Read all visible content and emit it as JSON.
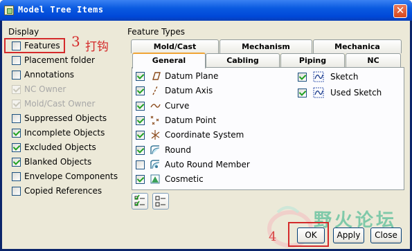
{
  "window": {
    "title": "Model Tree Items",
    "close_glyph": "✕"
  },
  "display": {
    "heading": "Display",
    "items": [
      {
        "label": "Features",
        "checked": false,
        "enabled": true
      },
      {
        "label": "Placement folder",
        "checked": false,
        "enabled": true
      },
      {
        "label": "Annotations",
        "checked": false,
        "enabled": true
      },
      {
        "label": "NC Owner",
        "checked": true,
        "enabled": false
      },
      {
        "label": "Mold/Cast Owner",
        "checked": true,
        "enabled": false
      },
      {
        "label": "Suppressed Objects",
        "checked": false,
        "enabled": true
      },
      {
        "label": "Incomplete Objects",
        "checked": true,
        "enabled": true
      },
      {
        "label": "Excluded Objects",
        "checked": true,
        "enabled": true
      },
      {
        "label": "Blanked Objects",
        "checked": true,
        "enabled": true
      },
      {
        "label": "Envelope Components",
        "checked": false,
        "enabled": true
      },
      {
        "label": "Copied References",
        "checked": false,
        "enabled": true
      }
    ]
  },
  "annotation_3": {
    "number": "3",
    "text": "打钩"
  },
  "annotation_4": {
    "number": "4"
  },
  "feature_types": {
    "heading": "Feature Types",
    "tabs_back": [
      "Mold/Cast",
      "Mechanism",
      "Mechanica"
    ],
    "tabs_front": [
      "General",
      "Cabling",
      "Piping",
      "NC"
    ],
    "active_tab": "General",
    "left_items": [
      {
        "label": "Datum Plane",
        "checked": true,
        "icon": "datum-plane-icon"
      },
      {
        "label": "Datum Axis",
        "checked": true,
        "icon": "datum-axis-icon"
      },
      {
        "label": "Curve",
        "checked": true,
        "icon": "curve-icon"
      },
      {
        "label": "Datum Point",
        "checked": true,
        "icon": "datum-point-icon"
      },
      {
        "label": "Coordinate System",
        "checked": true,
        "icon": "coordinate-system-icon"
      },
      {
        "label": "Round",
        "checked": true,
        "icon": "round-icon"
      },
      {
        "label": "Auto Round Member",
        "checked": false,
        "icon": "auto-round-icon"
      },
      {
        "label": "Cosmetic",
        "checked": true,
        "icon": "cosmetic-icon"
      }
    ],
    "right_items": [
      {
        "label": "Sketch",
        "checked": true,
        "icon": "sketch-icon"
      },
      {
        "label": "Used Sketch",
        "checked": true,
        "icon": "used-sketch-icon"
      }
    ]
  },
  "buttons": {
    "ok": "OK",
    "apply": "Apply",
    "close": "Close"
  },
  "watermark": {
    "text": "野火论坛"
  }
}
